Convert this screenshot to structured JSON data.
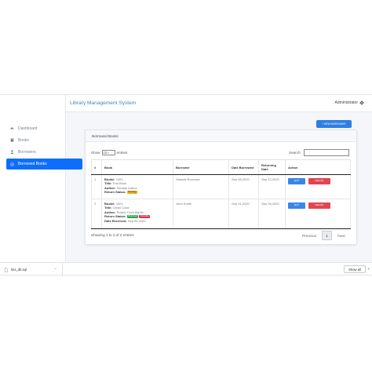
{
  "app": {
    "title": "Library Management System",
    "user": "Administrator"
  },
  "sidebar": {
    "items": [
      {
        "label": "Dashboard",
        "icon": "tachometer-icon",
        "active": false
      },
      {
        "label": "Books",
        "icon": "book-icon",
        "active": false
      },
      {
        "label": "Borrowers",
        "icon": "user-icon",
        "active": false
      },
      {
        "label": "Borrowed Books",
        "icon": "bookmark-icon",
        "active": true
      }
    ]
  },
  "main": {
    "new_button_label": "+ NEW BORROWER",
    "card_title": "Borrowed Books",
    "show_label": "Show",
    "entries_value": "10",
    "entries_label": "entries",
    "search_label": "Search:",
    "search_value": "",
    "columns": [
      "#",
      "Book",
      "Borrower",
      "Date Borrowed",
      "Returning Date",
      "Action"
    ],
    "rows": [
      {
        "num": "1",
        "book_id_label": "Book#:",
        "book_id": "1000",
        "title_label": "Title:",
        "title": "Test Book",
        "author_label": "Author:",
        "author": "Sample Author",
        "status_label": "Return Status:",
        "badges": [
          "Pending"
        ],
        "received_label": "",
        "received": "",
        "borrower": "Sample Borrower",
        "date_borrowed": "Sep 06,2020",
        "returning_date": "Sep 12,2020",
        "edit_label": "EDIT",
        "delete_label": "DELETE"
      },
      {
        "num": "2",
        "book_id_label": "Book#:",
        "book_id": "1001",
        "title_label": "Title:",
        "title": "Clean Code",
        "author_label": "Author:",
        "author": "Robert Cecil Martin",
        "status_label": "Return Status:",
        "badges": [
          "Returned",
          "Overdue"
        ],
        "received_label": "Date Received:",
        "received": "Sep 09,2020",
        "borrower": "John Smith",
        "date_borrowed": "Sep 01,2020",
        "returning_date": "Sep 08,2020",
        "edit_label": "EDIT",
        "delete_label": "DELETE"
      }
    ],
    "info_text": "Showing 1 to 2 of 2 entries",
    "pagination": {
      "prev": "Previous",
      "page": "1",
      "next": "Next"
    }
  },
  "download_bar": {
    "file_name": "lms_db.sql",
    "show_all_label": "Show all",
    "close_glyph": "×"
  },
  "colors": {
    "primary": "#0d6efd",
    "title_blue": "#3b87c4",
    "edit": "#3a86e6",
    "delete": "#e24552",
    "pending": "#f0ad1e",
    "returned": "#28a745",
    "overdue": "#dc3545"
  }
}
